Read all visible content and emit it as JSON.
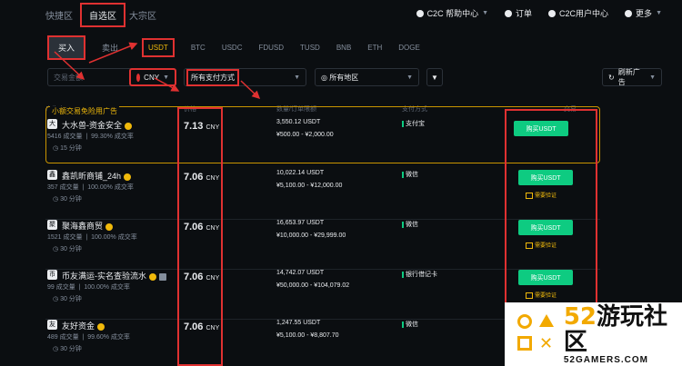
{
  "nav": {
    "tabs": [
      "快捷区",
      "自选区",
      "大宗区"
    ],
    "right": [
      {
        "label": "C2C 帮助中心",
        "icon": "help-icon"
      },
      {
        "label": "订单",
        "icon": "order-icon"
      },
      {
        "label": "C2C用户中心",
        "icon": "user-icon"
      },
      {
        "label": "更多",
        "icon": "more-icon"
      }
    ]
  },
  "trade": {
    "buy": "买入",
    "sell": "卖出",
    "coins": [
      "USDT",
      "BTC",
      "USDC",
      "FDUSD",
      "TUSD",
      "BNB",
      "ETH",
      "DOGE"
    ]
  },
  "filters": {
    "amount_placeholder": "交易金额",
    "currency": "CNY",
    "payment": "所有支付方式",
    "region": "所有地区",
    "refresh": "刷新广告"
  },
  "columns": [
    "广告方",
    "价格",
    "数量/订单限额",
    "支付方式",
    "交易"
  ],
  "promo_label": "小额交易免险用广告",
  "ads": [
    {
      "avatar": "大",
      "name": "大水兽-资金安全",
      "orders": "5416 成交量",
      "rate": "99.30% 成交率",
      "time": "15 分钟",
      "price": "7.13",
      "unit": "CNY",
      "available": "3,550.12 USDT",
      "limits": "¥500.00 - ¥2,000.00",
      "payment": "支付宝",
      "action": "购买USDT",
      "requirement": ""
    },
    {
      "avatar": "鑫",
      "name": "鑫凯昕商铺_24h",
      "orders": "357 成交量",
      "rate": "100.00% 成交率",
      "time": "30 分钟",
      "price": "7.06",
      "unit": "CNY",
      "available": "10,022.14 USDT",
      "limits": "¥5,100.00 - ¥12,000.00",
      "payment": "微信",
      "action": "购买USDT",
      "requirement": "需要验证"
    },
    {
      "avatar": "聚",
      "name": "聚海鑫商贸",
      "orders": "1521 成交量",
      "rate": "100.00% 成交率",
      "time": "30 分钟",
      "price": "7.06",
      "unit": "CNY",
      "available": "16,653.97 USDT",
      "limits": "¥10,000.00 - ¥29,999.00",
      "payment": "微信",
      "action": "购买USDT",
      "requirement": "需要验证"
    },
    {
      "avatar": "币",
      "name": "币友满运-实名查验流水",
      "orders": "99 成交量",
      "rate": "100.00% 成交率",
      "time": "30 分钟",
      "price": "7.06",
      "unit": "CNY",
      "available": "14,742.07 USDT",
      "limits": "¥50,000.00 - ¥104,079.02",
      "payment": "银行借记卡",
      "action": "购买USDT",
      "requirement": "需要验证"
    },
    {
      "avatar": "友",
      "name": "友好资金",
      "orders": "489 成交量",
      "rate": "99.60% 成交率",
      "time": "30 分钟",
      "price": "7.06",
      "unit": "CNY",
      "available": "1,247.55 USDT",
      "limits": "¥5,100.00 - ¥8,807.70",
      "payment": "微信",
      "action": "",
      "requirement": ""
    }
  ],
  "watermark": {
    "brand_num": "52",
    "brand_text": "游玩社区",
    "domain": "52GAMERS.COM"
  }
}
